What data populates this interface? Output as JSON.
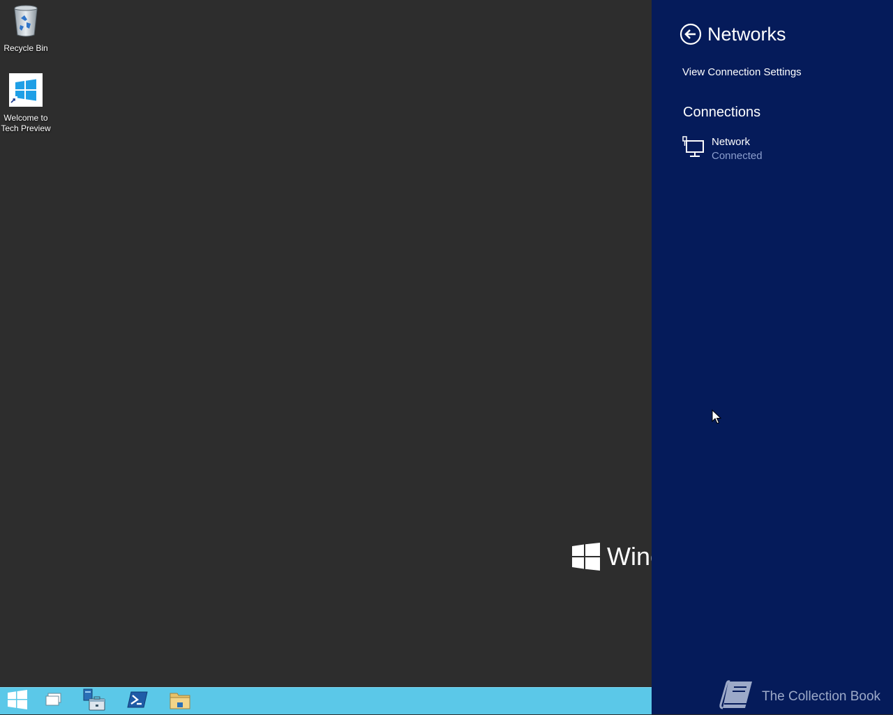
{
  "desktop": {
    "icons": [
      {
        "label_line1": "Recycle Bin",
        "label_line2": ""
      },
      {
        "label_line1": "Welcome to",
        "label_line2": "Tech Preview"
      }
    ],
    "watermark_text": "Winc"
  },
  "taskbar": {
    "items": [
      "start-icon",
      "task-view-icon",
      "server-manager-icon",
      "powershell-icon",
      "file-explorer-icon"
    ]
  },
  "charm": {
    "title": "Networks",
    "view_settings_label": "View Connection Settings",
    "connections_heading": "Connections",
    "network": {
      "name": "Network",
      "status": "Connected"
    }
  },
  "brand": {
    "text": "The Collection Book"
  },
  "colors": {
    "desktop_bg": "#2d2d2d",
    "taskbar_bg": "#5bc8e8",
    "charm_bg": "#051b5a",
    "status_text": "#8c9fce"
  }
}
